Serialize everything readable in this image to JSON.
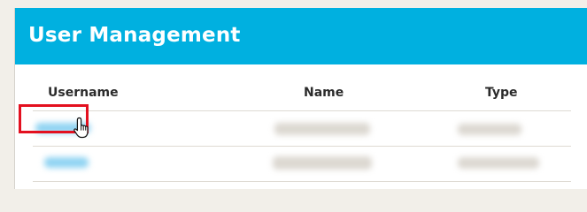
{
  "panel": {
    "title": "User Management"
  },
  "table": {
    "columns": [
      "Username",
      "Name",
      "Type"
    ],
    "rows": [
      {
        "username": "",
        "name": "",
        "type": ""
      },
      {
        "username": "",
        "name": "",
        "type": ""
      }
    ]
  },
  "annotation": {
    "highlight_color": "#e3101f"
  },
  "cursor": {
    "icon": "hand-pointer-icon"
  },
  "colors": {
    "header_bg": "#00b0e0",
    "page_bg": "#f2efe9",
    "link": "#2aa7e0"
  }
}
